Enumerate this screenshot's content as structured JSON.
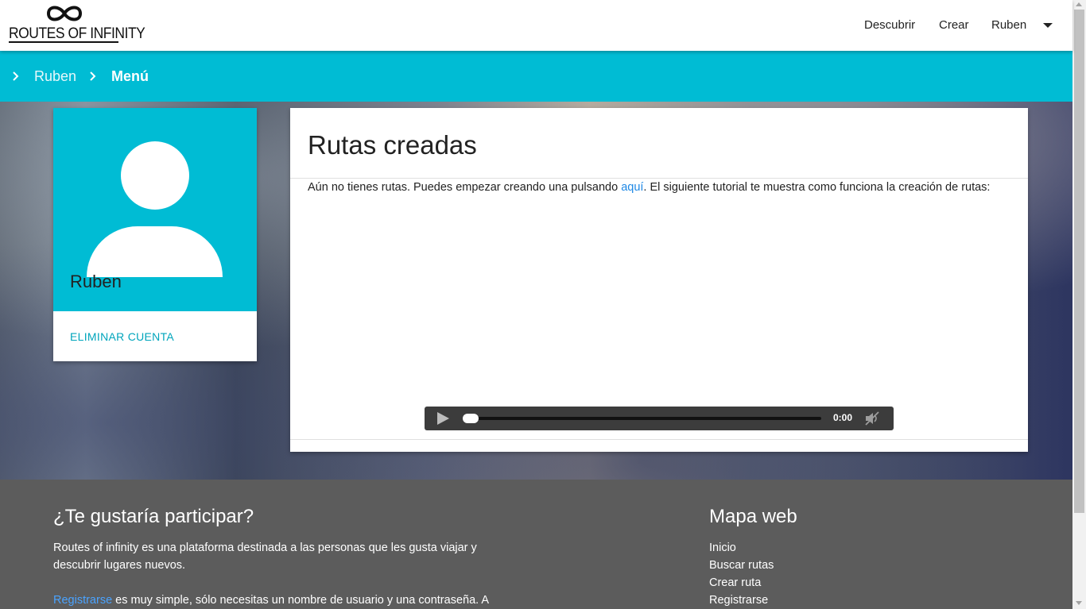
{
  "header": {
    "logo_text": "ROUTES OF INFINITY",
    "nav": {
      "discover": "Descubrir",
      "create": "Crear",
      "user": "Ruben"
    }
  },
  "breadcrumb": {
    "items": [
      "Ruben",
      "Menú"
    ]
  },
  "profile": {
    "name": "Ruben",
    "delete_account": "ELIMINAR CUENTA"
  },
  "main": {
    "title": "Rutas creadas",
    "text_before": "Aún no tienes rutas. Puedes empezar creando una pulsando ",
    "link": "aquí",
    "text_after": ". El siguiente tutorial te muestra como funciona la creación de rutas:",
    "player": {
      "time": "0:00",
      "progress": 0
    }
  },
  "footer": {
    "participate_title": "¿Te gustaría participar?",
    "participate_text": "Routes of infinity es una plataforma destinada a las personas que les gusta viajar y descubrir lugares nuevos.",
    "register_link": "Registrarse",
    "register_text": " es muy simple, sólo necesitas un nombre de usuario y una contraseña. A",
    "sitemap_title": "Mapa web",
    "sitemap_links": [
      "Inicio",
      "Buscar rutas",
      "Crear ruta",
      "Registrarse"
    ]
  },
  "colors": {
    "accent": "#00bcd4",
    "link": "#1e88e5",
    "footer_bg": "#5c5c5c"
  }
}
